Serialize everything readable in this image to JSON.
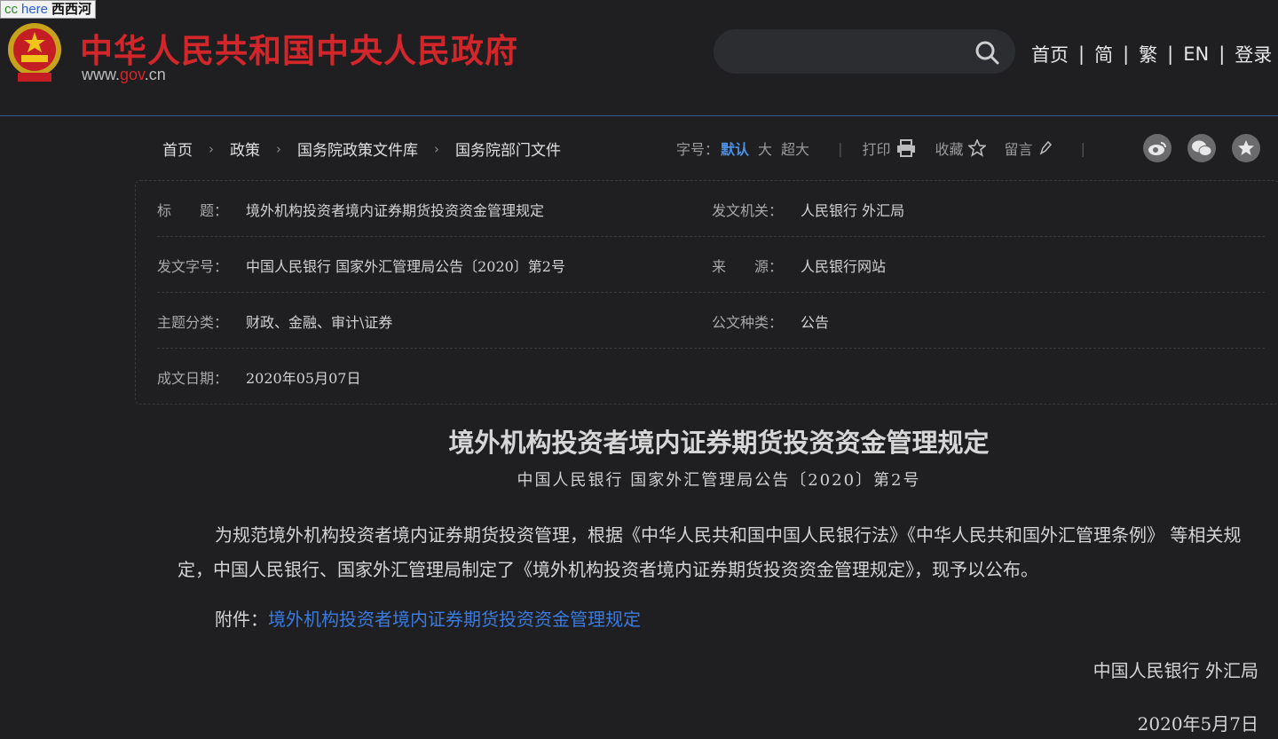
{
  "watermark": {
    "cc": "cc",
    "here": "here",
    "cn": "西西河"
  },
  "header": {
    "site_title": "中华人民共和国中央人民政府",
    "url_prefix": "www.",
    "url_gov": "gov",
    "url_suffix": ".cn",
    "search_placeholder": "",
    "nav": [
      "首页",
      "简",
      "繁",
      "EN",
      "登录"
    ]
  },
  "breadcrumb": [
    "首页",
    "政策",
    "国务院政策文件库",
    "国务院部门文件"
  ],
  "tools": {
    "font_label": "字号：",
    "font_default": "默认",
    "font_large": "大",
    "font_xlarge": "超大",
    "print": "打印",
    "favorite": "收藏",
    "comment": "留言"
  },
  "info": {
    "title_k": "标　　题：",
    "title_v": "境外机构投资者境内证券期货投资资金管理规定",
    "issuer_k": "发文机关：",
    "issuer_v": "人民银行 外汇局",
    "docno_k": "发文字号：",
    "docno_v": "中国人民银行 国家外汇管理局公告〔2020〕第2号",
    "source_k": "来　　源：",
    "source_v": "人民银行网站",
    "topic_k": "主题分类：",
    "topic_v": "财政、金融、审计\\证券",
    "type_k": "公文种类：",
    "type_v": "公告",
    "date_k": "成文日期：",
    "date_v": "2020年05月07日"
  },
  "article": {
    "title": "境外机构投资者境内证券期货投资资金管理规定",
    "subtitle": "中国人民银行 国家外汇管理局公告〔2020〕第2号",
    "body": "为规范境外机构投资者境内证券期货投资管理，根据《中华人民共和国中国人民银行法》《中华人民共和国外汇管理条例》 等相关规定，中国人民银行、国家外汇管理局制定了《境外机构投资者境内证券期货投资资金管理规定》，现予以公布。",
    "attach_label": "附件：",
    "attach_link": "境外机构投资者境内证券期货投资资金管理规定",
    "signature": "中国人民银行 外汇局",
    "date": "2020年5月7日"
  },
  "colors": {
    "accent": "#4a90e2",
    "brand_red": "#d3262a",
    "link": "#3a7be0",
    "background": "#1f1f22"
  }
}
